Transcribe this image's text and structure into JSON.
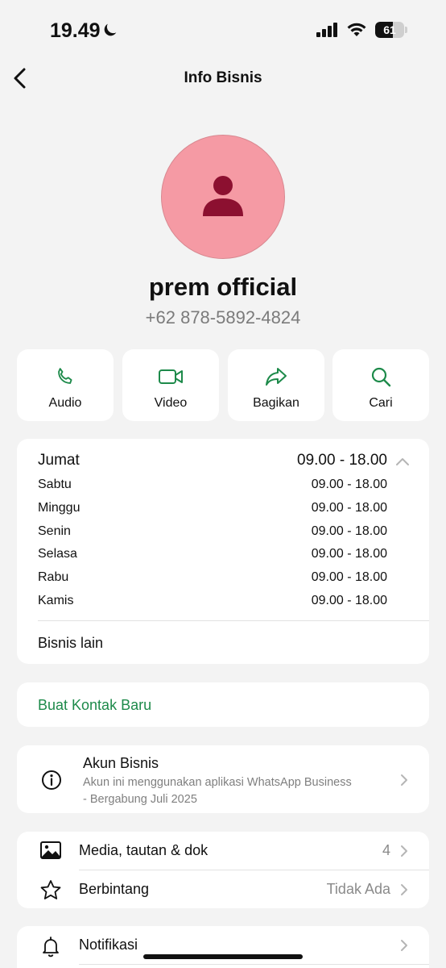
{
  "status_bar": {
    "time": "19.49",
    "battery_level": "61",
    "battery_fraction": 0.61
  },
  "header": {
    "title": "Info Bisnis",
    "back_icon": "chevron-left-icon"
  },
  "profile": {
    "name": "prem official",
    "phone": "+62 878-5892-4824",
    "avatar_color": "#f59aa4"
  },
  "actions": [
    {
      "label": "Audio",
      "icon": "phone-icon"
    },
    {
      "label": "Video",
      "icon": "video-icon"
    },
    {
      "label": "Bagikan",
      "icon": "share-icon"
    },
    {
      "label": "Cari",
      "icon": "search-icon"
    }
  ],
  "hours": {
    "current": {
      "day": "Jumat",
      "time": "09.00 - 18.00"
    },
    "others": [
      {
        "day": "Sabtu",
        "time": "09.00 - 18.00"
      },
      {
        "day": "Minggu",
        "time": "09.00 - 18.00"
      },
      {
        "day": "Senin",
        "time": "09.00 - 18.00"
      },
      {
        "day": "Selasa",
        "time": "09.00 - 18.00"
      },
      {
        "day": "Rabu",
        "time": "09.00 - 18.00"
      },
      {
        "day": "Kamis",
        "time": "09.00 - 18.00"
      }
    ],
    "other_business": "Bisnis lain"
  },
  "new_contact": {
    "label": "Buat Kontak Baru"
  },
  "business_account": {
    "title": "Akun Bisnis",
    "description_line1": "Akun ini menggunakan aplikasi WhatsApp Business",
    "description_line2": "- Bergabung Juli 2025"
  },
  "media": {
    "media_label": "Media, tautan & dok",
    "media_count": "4",
    "starred_label": "Berbintang",
    "starred_value": "Tidak Ada"
  },
  "notifications": {
    "label": "Notifikasi"
  },
  "colors": {
    "accent_green": "#1d8a4a",
    "background": "#f3f3f3"
  }
}
